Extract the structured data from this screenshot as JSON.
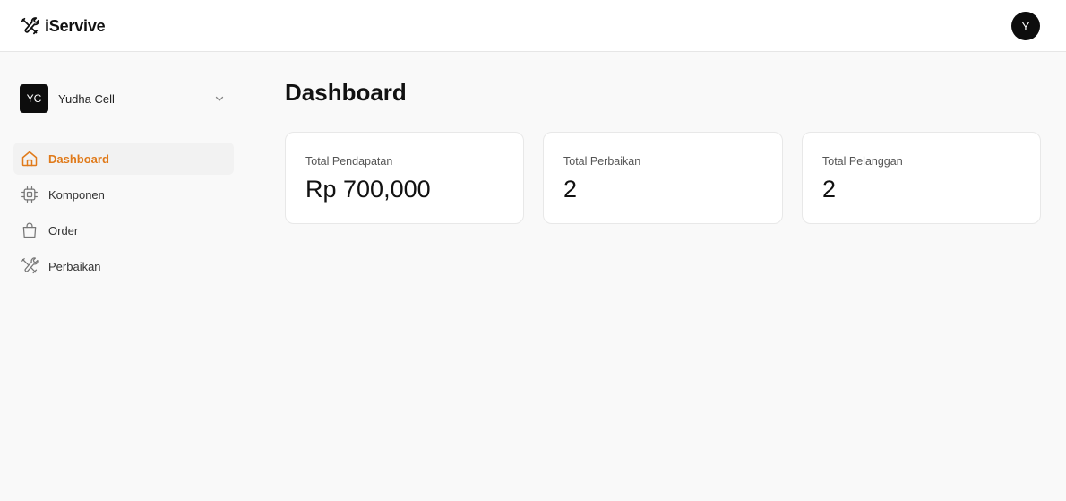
{
  "app": {
    "name": "iServive"
  },
  "user": {
    "avatar_initial": "Y"
  },
  "store": {
    "badge": "YC",
    "name": "Yudha Cell"
  },
  "sidebar": {
    "items": [
      {
        "label": "Dashboard",
        "icon": "home-icon",
        "active": true
      },
      {
        "label": "Komponen",
        "icon": "chip-icon",
        "active": false
      },
      {
        "label": "Order",
        "icon": "shopping-bag-icon",
        "active": false
      },
      {
        "label": "Perbaikan",
        "icon": "tools-icon",
        "active": false
      }
    ]
  },
  "main": {
    "title": "Dashboard",
    "cards": [
      {
        "label": "Total Pendapatan",
        "value": "Rp 700,000"
      },
      {
        "label": "Total Perbaikan",
        "value": "2"
      },
      {
        "label": "Total Pelanggan",
        "value": "2"
      }
    ]
  },
  "colors": {
    "accent": "#e07a1a",
    "dark": "#0d0d0d",
    "background": "#f9f9f9"
  }
}
